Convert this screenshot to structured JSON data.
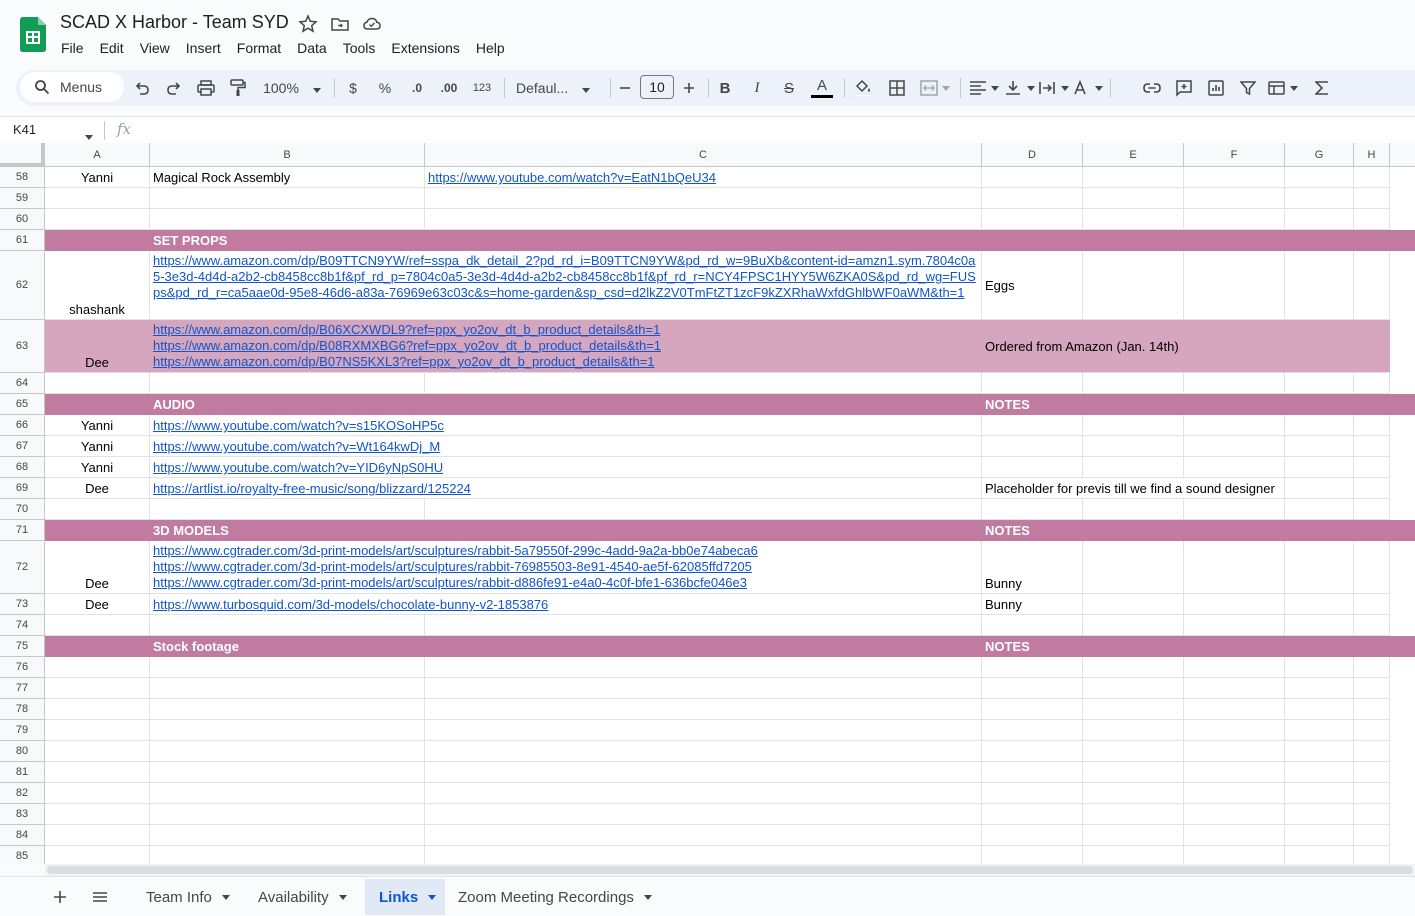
{
  "app": {
    "doc_title": "SCAD X Harbor - Team SYD",
    "menus": [
      "File",
      "Edit",
      "View",
      "Insert",
      "Format",
      "Data",
      "Tools",
      "Extensions",
      "Help"
    ]
  },
  "toolbar": {
    "search_label": "Menus",
    "zoom": "100%",
    "currency": "$",
    "percent": "%",
    "dec_decrease": ".0",
    "dec_increase": ".00",
    "number_format": "123",
    "font": "Defaul...",
    "font_size": "10",
    "bold": "B",
    "italic": "I",
    "strike": "S",
    "text_color": "A"
  },
  "formula_bar": {
    "name_box": "K41",
    "fx": "fx",
    "content": ""
  },
  "columns": [
    "A",
    "B",
    "C",
    "D",
    "E",
    "F",
    "G",
    "H"
  ],
  "rows": [
    {
      "num": "58",
      "a": "Yanni",
      "b": "Magical Rock Assembly",
      "c": "https://www.youtube.com/watch?v=EatN1bQeU34",
      "d": ""
    },
    {
      "num": "59",
      "a": "",
      "b": "",
      "c": "",
      "d": ""
    },
    {
      "num": "60",
      "a": "",
      "b": "",
      "c": "",
      "d": ""
    },
    {
      "num": "61",
      "a": "",
      "b": "SET PROPS",
      "c": "",
      "d": ""
    },
    {
      "num": "62",
      "a": "shashank",
      "b": "https://www.amazon.com/dp/B09TTCN9YW/ref=sspa_dk_detail_2?pd_rd_i=B09TTCN9YW&pd_rd_w=9BuXb&content-id=amzn1.sym.7804c0a5-3e3d-4d4d-a2b2-cb8458cc8b1f&pf_rd_p=7804c0a5-3e3d-4d4d-a2b2-cb8458cc8b1f&pf_rd_r=NCY4FPSC1HYY5W6ZKA0S&pd_rd_wg=FUSps&pd_rd_r=ca5aae0d-95e8-46d6-a83a-76969e63c03c&s=home-garden&sp_csd=d2lkZ2V0TmFtZT1zcF9kZXRhaWxfdGhlbWF0aWM&th=1",
      "c": "",
      "d": "Eggs"
    },
    {
      "num": "63",
      "a": "Dee",
      "b": "https://www.amazon.com/dp/B06XCXWDL9?ref=ppx_yo2ov_dt_b_product_details&th=1\nhttps://www.amazon.com/dp/B08RXMXBG6?ref=ppx_yo2ov_dt_b_product_details&th=1\nhttps://www.amazon.com/dp/B07NS5KXL3?ref=ppx_yo2ov_dt_b_product_details&th=1",
      "c": "",
      "d": "Ordered from Amazon (Jan. 14th)"
    },
    {
      "num": "64",
      "a": "",
      "b": "",
      "c": "",
      "d": ""
    },
    {
      "num": "65",
      "a": "",
      "b": "AUDIO",
      "c": "",
      "d": "NOTES"
    },
    {
      "num": "66",
      "a": "Yanni",
      "b": "https://www.youtube.com/watch?v=s15KOSoHP5c",
      "c": "",
      "d": ""
    },
    {
      "num": "67",
      "a": "Yanni",
      "b": "https://www.youtube.com/watch?v=Wt164kwDj_M",
      "c": "",
      "d": ""
    },
    {
      "num": "68",
      "a": "Yanni",
      "b": "https://www.youtube.com/watch?v=YID6yNpS0HU",
      "c": "",
      "d": ""
    },
    {
      "num": "69",
      "a": "Dee",
      "b": "https://artlist.io/royalty-free-music/song/blizzard/125224",
      "c": "",
      "d": "Placeholder for previs till we find a sound designer"
    },
    {
      "num": "70",
      "a": "",
      "b": "",
      "c": "",
      "d": ""
    },
    {
      "num": "71",
      "a": "",
      "b": "3D MODELS",
      "c": "",
      "d": "NOTES"
    },
    {
      "num": "72",
      "a": "Dee",
      "b": "https://www.cgtrader.com/3d-print-models/art/sculptures/rabbit-5a79550f-299c-4add-9a2a-bb0e74abeca6\nhttps://www.cgtrader.com/3d-print-models/art/sculptures/rabbit-76985503-8e91-4540-ae5f-62085ffd7205\nhttps://www.cgtrader.com/3d-print-models/art/sculptures/rabbit-d886fe91-e4a0-4c0f-bfe1-636bcfe046e3",
      "c": "",
      "d": "Bunny"
    },
    {
      "num": "73",
      "a": "Dee",
      "b": "https://www.turbosquid.com/3d-models/chocolate-bunny-v2-1853876",
      "c": "",
      "d": "Bunny"
    },
    {
      "num": "74",
      "a": "",
      "b": "",
      "c": "",
      "d": ""
    },
    {
      "num": "75",
      "a": "",
      "b": "Stock footage",
      "c": "",
      "d": "NOTES"
    },
    {
      "num": "76",
      "a": "",
      "b": "",
      "c": "",
      "d": ""
    },
    {
      "num": "77",
      "a": "",
      "b": "",
      "c": "",
      "d": ""
    },
    {
      "num": "78",
      "a": "",
      "b": "",
      "c": "",
      "d": ""
    },
    {
      "num": "79",
      "a": "",
      "b": "",
      "c": "",
      "d": ""
    },
    {
      "num": "80",
      "a": "",
      "b": "",
      "c": "",
      "d": ""
    },
    {
      "num": "81",
      "a": "",
      "b": "",
      "c": "",
      "d": ""
    },
    {
      "num": "82",
      "a": "",
      "b": "",
      "c": "",
      "d": ""
    },
    {
      "num": "83",
      "a": "",
      "b": "",
      "c": "",
      "d": ""
    },
    {
      "num": "84",
      "a": "",
      "b": "",
      "c": "",
      "d": ""
    },
    {
      "num": "85",
      "a": "",
      "b": "",
      "c": "",
      "d": ""
    }
  ],
  "sheet_tabs": [
    {
      "label": "Team Info",
      "active": false
    },
    {
      "label": "Availability",
      "active": false
    },
    {
      "label": "Links",
      "active": true
    },
    {
      "label": "Zoom Meeting Recordings",
      "active": false
    }
  ],
  "colors": {
    "section_header": "#c27ba0",
    "highlight_row": "#d5a6bd",
    "link": "#1155cc",
    "active_tab": "#0b57d0"
  }
}
